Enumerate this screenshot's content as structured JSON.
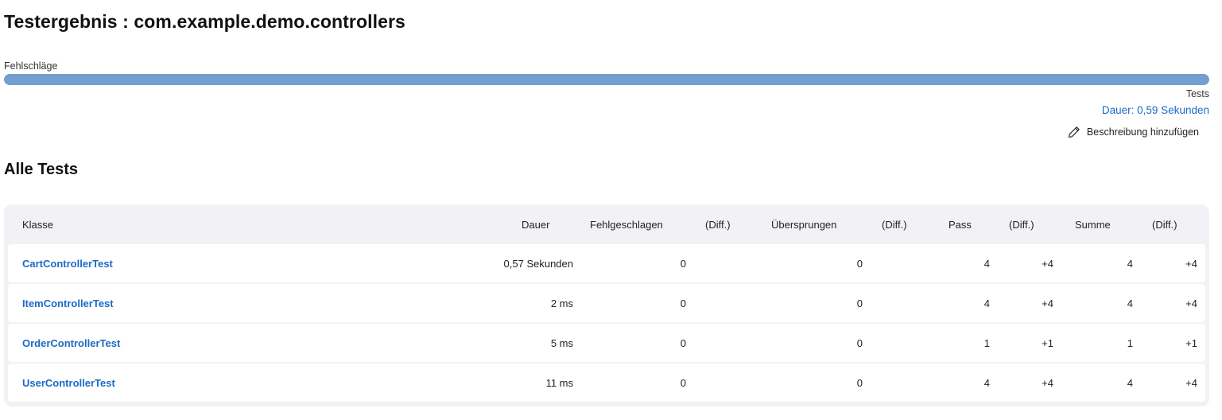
{
  "page": {
    "title": "Testergebnis : com.example.demo.controllers"
  },
  "summary": {
    "failures_label": "Fehlschläge",
    "tests_label": "Tests",
    "duration_label": "Dauer: 0,59 Sekunden",
    "pass_fraction": 1.0,
    "add_description_label": "Beschreibung hinzufügen"
  },
  "all_tests": {
    "title": "Alle Tests",
    "columns": {
      "class": "Klasse",
      "duration": "Dauer",
      "failed": "Fehlgeschlagen",
      "failed_diff": "(Diff.)",
      "skipped": "Übersprungen",
      "skipped_diff": "(Diff.)",
      "pass": "Pass",
      "pass_diff": "(Diff.)",
      "total": "Summe",
      "total_diff": "(Diff.)"
    },
    "rows": [
      {
        "class": "CartControllerTest",
        "duration": "0,57 Sekunden",
        "failed": "0",
        "failed_diff": "",
        "skipped": "0",
        "skipped_diff": "",
        "pass": "4",
        "pass_diff": "+4",
        "total": "4",
        "total_diff": "+4"
      },
      {
        "class": "ItemControllerTest",
        "duration": "2 ms",
        "failed": "0",
        "failed_diff": "",
        "skipped": "0",
        "skipped_diff": "",
        "pass": "4",
        "pass_diff": "+4",
        "total": "4",
        "total_diff": "+4"
      },
      {
        "class": "OrderControllerTest",
        "duration": "5 ms",
        "failed": "0",
        "failed_diff": "",
        "skipped": "0",
        "skipped_diff": "",
        "pass": "1",
        "pass_diff": "+1",
        "total": "1",
        "total_diff": "+1"
      },
      {
        "class": "UserControllerTest",
        "duration": "11 ms",
        "failed": "0",
        "failed_diff": "",
        "skipped": "0",
        "skipped_diff": "",
        "pass": "4",
        "pass_diff": "+4",
        "total": "4",
        "total_diff": "+4"
      }
    ]
  },
  "colors": {
    "progress_fill": "#729fcf",
    "link": "#1b6ac6"
  },
  "icons": {
    "edit": "pencil-icon"
  }
}
